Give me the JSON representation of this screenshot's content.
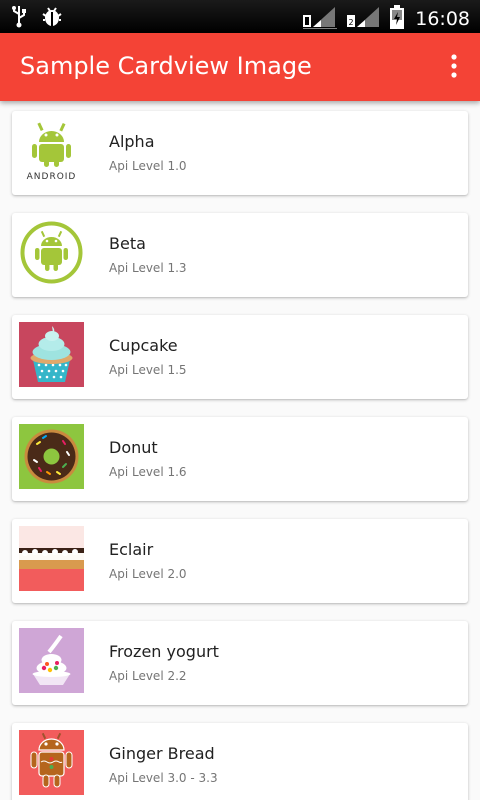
{
  "status_bar": {
    "time": "16:08"
  },
  "app_bar": {
    "title": "Sample Cardview Image"
  },
  "cards": [
    {
      "title": "Alpha",
      "subtitle": "Api Level 1.0",
      "image": "android-logo-icon"
    },
    {
      "title": "Beta",
      "subtitle": "Api Level 1.3",
      "image": "android-robot-circle-icon"
    },
    {
      "title": "Cupcake",
      "subtitle": "Api Level 1.5",
      "image": "cupcake-image"
    },
    {
      "title": "Donut",
      "subtitle": "Api Level 1.6",
      "image": "donut-image"
    },
    {
      "title": "Eclair",
      "subtitle": "Api Level 2.0",
      "image": "eclair-image"
    },
    {
      "title": "Frozen yogurt",
      "subtitle": "Api Level 2.2",
      "image": "frozen-yogurt-image"
    },
    {
      "title": "Ginger Bread",
      "subtitle": "Api Level 3.0 - 3.3",
      "image": "gingerbread-image"
    }
  ],
  "colors": {
    "accent": "#f44336",
    "android_green": "#a4c639"
  }
}
